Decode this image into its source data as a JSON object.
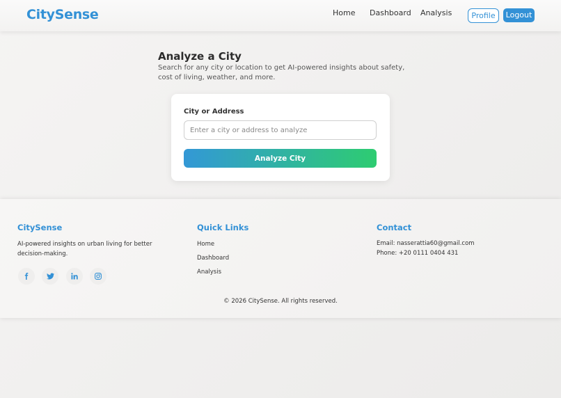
{
  "header": {
    "brand": "CitySense",
    "nav": [
      "Home",
      "Dashboard",
      "Analysis"
    ],
    "profile_label": "Profile",
    "logout_label": "Logout"
  },
  "main": {
    "title": "Analyze a City",
    "subtitle": "Search for any city or location to get AI-powered insights about safety, cost of living, weather, and more.",
    "field_label": "City or Address",
    "input_placeholder": "Enter a city or address to analyze",
    "input_value": "",
    "button_label": "Analyze City"
  },
  "footer": {
    "brand": "CitySense",
    "tagline": "AI-powered insights on urban living for better decision-making.",
    "social_icons": [
      "facebook-icon",
      "twitter-icon",
      "linkedin-icon",
      "instagram-icon"
    ],
    "quick_links_heading": "Quick Links",
    "quick_links": [
      "Home",
      "Dashboard",
      "Analysis"
    ],
    "contact_heading": "Contact",
    "email": "Email: nasserattia60@gmail.com",
    "phone": "Phone: +20 0111 0404 431",
    "copyright": "© 2026 CitySense. All rights reserved."
  },
  "colors": {
    "accent": "#3391d6",
    "gradient_start": "#3398d6",
    "gradient_end": "#2ecc71"
  }
}
